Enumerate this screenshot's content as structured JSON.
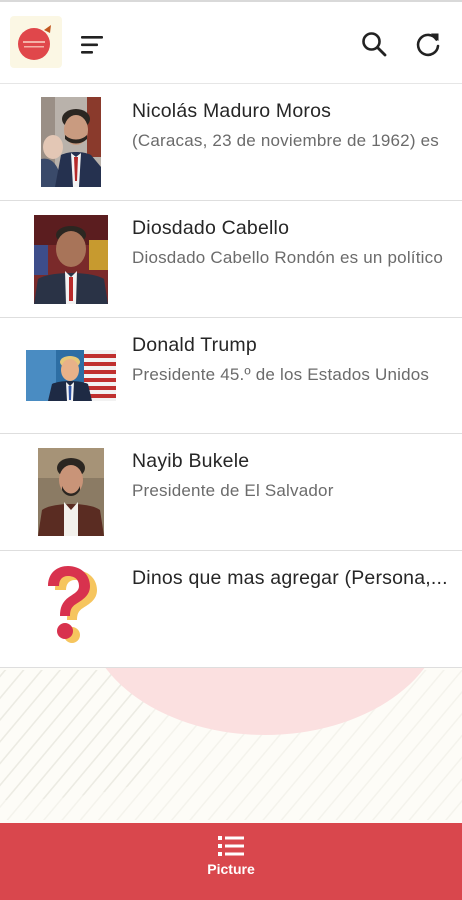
{
  "header": {
    "logo_icon": "app-logo",
    "menu_icon": "hamburger-menu-icon",
    "search_icon": "search-icon",
    "refresh_icon": "refresh-icon"
  },
  "list": {
    "items": [
      {
        "title": "Nicolás Maduro Moros",
        "subtitle": "(Caracas, 23 de noviembre de 1962) es",
        "thumb": "maduro-photo"
      },
      {
        "title": "Diosdado Cabello",
        "subtitle": "Diosdado Cabello Rondón es un político",
        "thumb": "cabello-photo"
      },
      {
        "title": "Donald Trump",
        "subtitle": "Presidente 45.º de los Estados Unidos",
        "thumb": "trump-photo"
      },
      {
        "title": "Nayib Bukele",
        "subtitle": "Presidente de El Salvador",
        "thumb": "bukele-photo"
      },
      {
        "title": "Dinos que mas agregar (Persona,...",
        "subtitle": "",
        "thumb": "question-mark-icon"
      }
    ]
  },
  "bottom_nav": {
    "tab_label": "Picture",
    "tab_icon": "list-icon"
  },
  "colors": {
    "accent": "#d9474d",
    "question_mark_red": "#d8324e",
    "question_mark_shadow": "#f6c55e",
    "background": "#fdfcf7"
  }
}
